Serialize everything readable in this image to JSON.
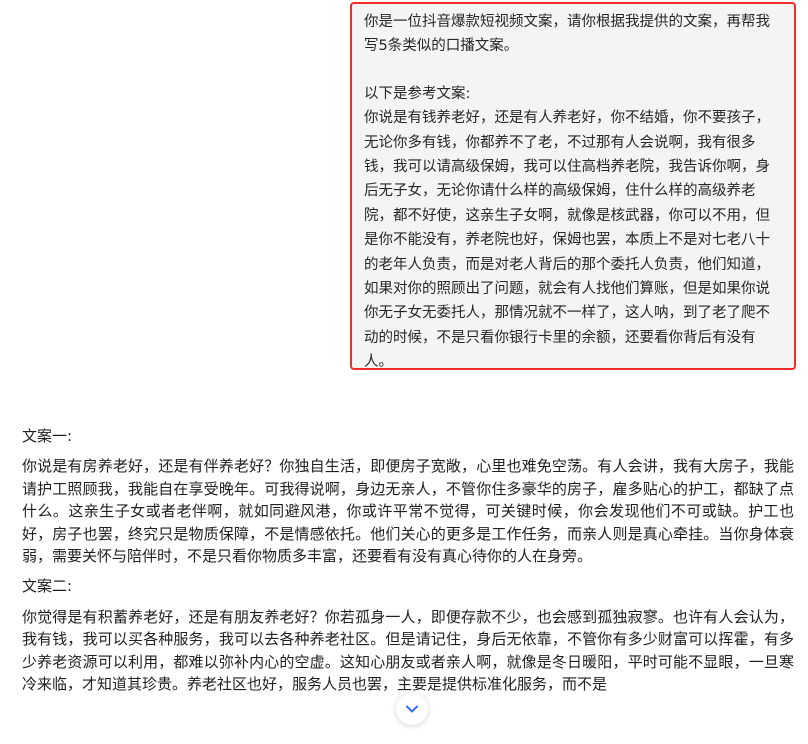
{
  "user_message": {
    "request": "你是一位抖音爆款短视频文案，请你根据我提供的文案，再帮我写5条类似的口播文案。",
    "reference_heading": "以下是参考文案:",
    "reference_text": "你说是有钱养老好，还是有人养老好，你不结婚，你不要孩子，无论你多有钱，你都养不了老，不过那有人会说啊，我有很多钱，我可以请高级保姆，我可以住高档养老院，我告诉你啊，身后无子女，无论你请什么样的高级保姆，住什么样的高级养老院，都不好使，这亲生子女啊，就像是核武器，你可以不用，但是你不能没有，养老院也好，保姆也罢，本质上不是对七老八十的老年人负责，而是对老人背后的那个委托人负责，他们知道，如果对你的照顾出了问题，就会有人找他们算账，但是如果你说你无子女无委托人，那情况就不一样了，这人呐，到了老了爬不动的时候，不是只看你银行卡里的余额，还要看你背后有没有人。"
  },
  "assistant_response": {
    "copy1_title": "文案一:",
    "copy1_text": "你说是有房养老好，还是有伴养老好？你独自生活，即便房子宽敞，心里也难免空荡。有人会讲，我有大房子，我能请护工照顾我，我能自在享受晚年。可我得说啊，身边无亲人，不管你住多豪华的房子，雇多贴心的护工，都缺了点什么。这亲生子女或者老伴啊，就如同避风港，你或许平常不觉得，可关键时候，你会发现他们不可或缺。护工也好，房子也罢，终究只是物质保障，不是情感依托。他们关心的更多是工作任务，而亲人则是真心牵挂。当你身体衰弱，需要关怀与陪伴时，不是只看你物质多丰富，还要看有没有真心待你的人在身旁。",
    "copy2_title": "文案二:",
    "copy2_text": "你觉得是有积蓄养老好，还是有朋友养老好？你若孤身一人，即便存款不少，也会感到孤独寂寥。也许有人会认为，我有钱，我可以买各种服务，我可以去各种养老社区。但是请记住，身后无依靠，不管你有多少财富可以挥霍，有多少养老资源可以利用，都难以弥补内心的空虚。这知心朋友或者亲人啊，就像是冬日暖阳，平时可能不显眼，一旦寒冷来临，才知道其珍贵。养老社区也好，服务人员也罢，主要是提供标准化服务，而不是"
  },
  "icons": {
    "scroll_down": "chevron-down-icon"
  },
  "colors": {
    "highlight_border": "#ef2d2d",
    "bubble_background": "#f4f4f5",
    "scroll_chevron": "#3370ff"
  }
}
